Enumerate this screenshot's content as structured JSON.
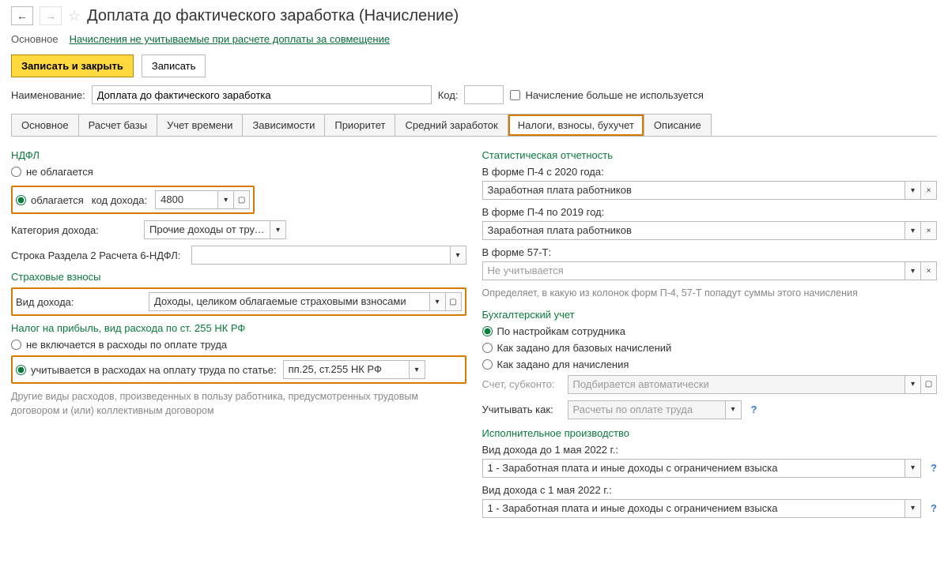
{
  "header": {
    "title": "Доплата до фактического заработка (Начисление)"
  },
  "toolbar": {
    "main": "Основное",
    "link": "Начисления не учитываемые при расчете доплаты за совмещение"
  },
  "actions": {
    "save_close": "Записать и закрыть",
    "save": "Записать"
  },
  "name_row": {
    "label": "Наименование:",
    "value": "Доплата до фактического заработка",
    "code_label": "Код:",
    "code_value": "",
    "checkbox_label": "Начисление больше не используется"
  },
  "tabs": {
    "items": [
      "Основное",
      "Расчет базы",
      "Учет времени",
      "Зависимости",
      "Приоритет",
      "Средний заработок",
      "Налоги, взносы, бухучет",
      "Описание"
    ],
    "active_index": 6
  },
  "left": {
    "ndfl_title": "НДФЛ",
    "ndfl_not_taxed": "не облагается",
    "ndfl_taxed": "облагается",
    "ndfl_code_label": "код дохода:",
    "ndfl_code_value": "4800",
    "income_cat_label": "Категория дохода:",
    "income_cat_value": "Прочие доходы от трудо",
    "row6_label": "Строка Раздела 2 Расчета 6-НДФЛ:",
    "row6_value": "",
    "insurance_title": "Страховые взносы",
    "insurance_kind_label": "Вид дохода:",
    "insurance_kind_value": "Доходы, целиком облагаемые страховыми взносами",
    "profit_title": "Налог на прибыль, вид расхода по ст. 255 НК РФ",
    "profit_not_included": "не включается в расходы по оплате труда",
    "profit_included": "учитывается в расходах на оплату труда по статье:",
    "profit_value": "пп.25, ст.255 НК РФ",
    "other_note": "Другие виды расходов, произведенных в пользу работника, предусмотренных трудовым договором и (или) коллективным договором"
  },
  "right": {
    "stat_title": "Статистическая отчетность",
    "p4_2020_label": "В форме П-4 с 2020 года:",
    "p4_2020_value": "Заработная плата работников",
    "p4_2019_label": "В форме П-4 по 2019 год:",
    "p4_2019_value": "Заработная плата работников",
    "f57t_label": "В форме 57-Т:",
    "f57t_value": "Не учитывается",
    "stat_note": "Определяет, в какую из колонок форм П-4, 57-Т попадут суммы этого начисления",
    "bu_title": "Бухгалтерский учет",
    "bu_by_emp": "По настройкам сотрудника",
    "bu_by_base": "Как задано для базовых начислений",
    "bu_by_accrual": "Как задано для начисления",
    "acct_label": "Счет, субконто:",
    "acct_value": "Подбирается автоматически",
    "treat_label": "Учитывать как:",
    "treat_value": "Расчеты по оплате труда",
    "exec_title": "Исполнительное производство",
    "inc_before_label": "Вид дохода до 1 мая 2022 г.:",
    "inc_before_value": "1 - Заработная плата и иные доходы с ограничением взыска",
    "inc_after_label": "Вид дохода с 1 мая 2022 г.:",
    "inc_after_value": "1 - Заработная плата и иные доходы с ограничением взыска"
  }
}
